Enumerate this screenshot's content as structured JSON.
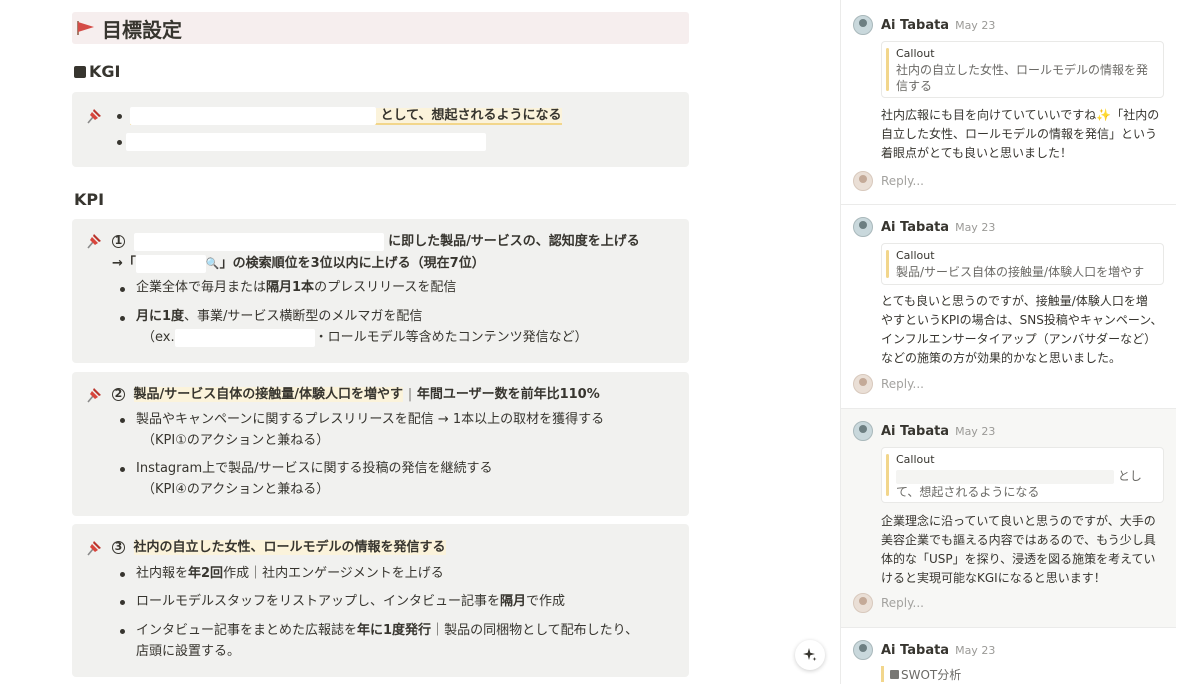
{
  "doc": {
    "title": "目標設定",
    "kgi_heading": "KGI",
    "kgi": {
      "line1_suffix": "として、想起されるようになる"
    },
    "kpi_heading": "KPI",
    "kpi1": {
      "num": "1",
      "line1": "に即した製品/サービスの、認知度を上げる",
      "line2_prefix": "→「",
      "line2_suffix": "」の検索順位を3位以内に上げる（現在7位）",
      "b1_a": "企業全体で毎月または",
      "b1_b": "隔月1本",
      "b1_c": "のプレスリリースを配信",
      "b2_a": "月に1度",
      "b2_b": "、事業/サービス横断型のメルマガを配信",
      "b2_line2_prefix": "（ex.",
      "b2_line2_suffix": "・ロールモデル等含めたコンテンツ発信など）"
    },
    "kpi2": {
      "num": "2",
      "title": "製品/サービス自体の接触量/体験人口を増やす",
      "sep": "|",
      "metric": "年間ユーザー数を前年比110%",
      "b1_line1": "製品やキャンペーンに関するプレスリリースを配信 → 1本以上の取材を獲得する",
      "b1_line2": "（KPI①のアクションと兼ねる）",
      "b2_line1": "Instagram上で製品/サービスに関する投稿の発信を継続する",
      "b2_line2": "（KPI④のアクションと兼ねる）"
    },
    "kpi3": {
      "num": "3",
      "title": "社内の自立した女性、ロールモデルの情報を発信する",
      "b1_a": "社内報を",
      "b1_b": "年2回",
      "b1_c": "作成｜社内エンゲージメントを上げる",
      "b2_a": "ロールモデルスタッフをリストアップし、インタビュー記事を",
      "b2_b": "隔月",
      "b2_c": "で作成",
      "b3_a": "インタビュー記事をまとめた広報誌を",
      "b3_b": "年に1度発行",
      "b3_c": "｜製品の同梱物として配布したり、",
      "b3_line2": "店頭に設置する。"
    }
  },
  "comments": [
    {
      "author": "Ai Tabata",
      "date": "May 23",
      "quote_label": "Callout",
      "quote_text": "社内の自立した女性、ロールモデルの情報を発信する",
      "body_line1_a": "社内広報にも目を向けていていいですね",
      "body_line1_sparkle": "✨",
      "body_line1_b": "「社内の",
      "body_line2": "自立した女性、ロールモデルの情報を発信」という",
      "body_line3": "着眼点がとても良いと思いました！",
      "reply": "Reply..."
    },
    {
      "author": "Ai Tabata",
      "date": "May 23",
      "quote_label": "Callout",
      "quote_text": "製品/サービス自体の接触量/体験人口を増やす",
      "body_line1": "とても良いと思うのですが、接触量/体験人口を増",
      "body_line2": "やすというKPIの場合は、SNS投稿やキャンペーン、",
      "body_line3": "インフルエンサータイアップ（アンバサダーなど）",
      "body_line4": "などの施策の方が効果的かなと思いました。",
      "reply": "Reply..."
    },
    {
      "author": "Ai Tabata",
      "date": "May 23",
      "quote_label": "Callout",
      "quote_text_a": "とし",
      "quote_text_b": "て、想起されるようになる",
      "body_line1": "企業理念に沿っていて良いと思うのですが、大手の",
      "body_line2": "美容企業でも謳える内容ではあるので、もう少し具",
      "body_line3": "体的な「USP」を探り、浸透を図る施策を考えてい",
      "body_line4": "けると実現可能なKGIになると思います！",
      "reply": "Reply..."
    },
    {
      "author": "Ai Tabata",
      "date": "May 23",
      "tag": "SWOT分析"
    }
  ],
  "colors": {
    "heading_bg": "#f6eeee",
    "callout_bg": "#f1f1ef",
    "highlight": "#fbf3db",
    "quote_bar": "#f2d68c",
    "flag_red": "#d44c47",
    "pin_red": "#d8453c"
  },
  "icons": [
    "triangular-flag-icon",
    "pushpin-icon",
    "magnifier-icon",
    "sparkle-ai-icon",
    "square-icon"
  ]
}
